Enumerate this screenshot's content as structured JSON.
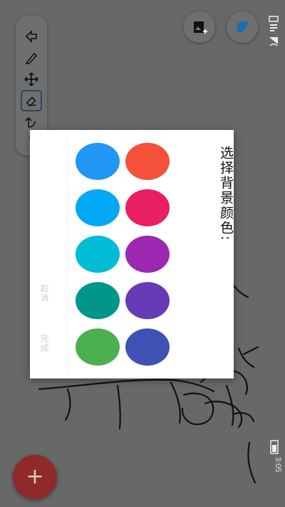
{
  "dialog": {
    "title": "选择背景颜色:",
    "cancel_label": "取消",
    "done_label": "完成",
    "colors_right": [
      "#f4503a",
      "#e91e63",
      "#9c27b0",
      "#673ab7",
      "#3f51b5"
    ],
    "colors_left": [
      "#2196f3",
      "#03a9f4",
      "#00bcd4",
      "#009688",
      "#4caf50"
    ]
  },
  "toolbar": {
    "tools": [
      "cursor-arrow-icon",
      "pencil-icon",
      "move-icon",
      "eraser-icon",
      "undo-icon",
      "redo-icon"
    ],
    "selected": "eraser-icon"
  },
  "top_buttons": [
    "add-image-icon",
    "drop-icon"
  ],
  "status_bar": {
    "time": "3:05"
  },
  "fab": {
    "label": "+"
  },
  "colors": {
    "background": "#686868",
    "fab": "#8e2a2a",
    "drop": "#1b6fb0"
  }
}
